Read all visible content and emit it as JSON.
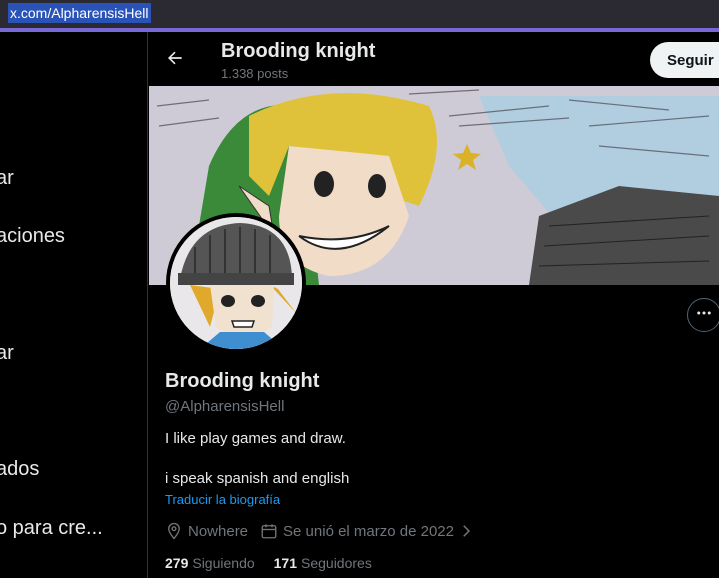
{
  "browser": {
    "url": "x.com/AlpharensisHell"
  },
  "sidebar": {
    "items": [
      {
        "label": "ar"
      },
      {
        "label": "aciones"
      },
      {
        "label": "ar"
      },
      {
        "label": "ados"
      },
      {
        "label": "o para cre..."
      }
    ]
  },
  "header": {
    "name": "Brooding knight",
    "posts": "1.338 posts",
    "follow_label": "Seguir"
  },
  "profile": {
    "name": "Brooding knight",
    "handle": "@AlpharensisHell",
    "bio_line1": "I like play games and draw.",
    "bio_line2": "i speak spanish and english",
    "translate": "Traducir la biografía",
    "location": "Nowhere",
    "joined": "Se unió el marzo de 2022",
    "following_count": "279",
    "following_label": "Siguiendo",
    "followers_count": "171",
    "followers_label": "Seguidores"
  },
  "icons": {
    "back": "arrow-left-icon",
    "more": "more-horizontal-icon",
    "location": "location-pin-icon",
    "calendar": "calendar-icon",
    "chevron": "chevron-right-icon"
  },
  "colors": {
    "background": "#000000",
    "link": "#1d9bf0",
    "secondary_text": "#71767b",
    "url_highlight": "#2a53b8"
  }
}
